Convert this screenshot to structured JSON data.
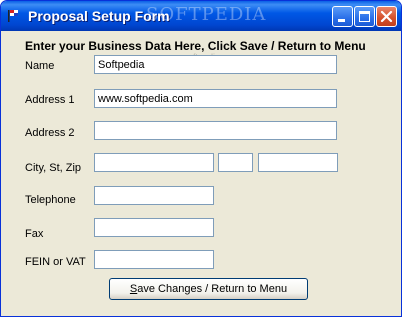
{
  "window": {
    "title": "Proposal Setup Form",
    "watermark": "SOFTPEDIA",
    "controls": {
      "minimize": "minimize",
      "maximize": "maximize",
      "close": "close"
    }
  },
  "form": {
    "heading": "Enter your Business Data Here, Click Save / Return to Menu",
    "sub_watermark": "www.softpedia.com",
    "fields": {
      "name": {
        "label": "Name",
        "value": "Softpedia"
      },
      "address1": {
        "label": "Address 1",
        "value": "www.softpedia.com"
      },
      "address2": {
        "label": "Address 2",
        "value": ""
      },
      "city_st_zip": {
        "label": "City, St, Zip",
        "city": "",
        "state": "",
        "zip": ""
      },
      "telephone": {
        "label": "Telephone",
        "value": ""
      },
      "fax": {
        "label": "Fax",
        "value": ""
      },
      "fein_vat": {
        "label": "FEIN or VAT",
        "value": ""
      }
    },
    "save_button": {
      "label_underlined": "S",
      "label_rest": "ave Changes / Return to Menu"
    }
  },
  "colors": {
    "titlebar": "#0058e6",
    "window_body": "#ece9d8",
    "field_border": "#7f9db9",
    "close_button": "#d4502a"
  },
  "icons": {
    "app": "flag-icon",
    "minimize": "minimize-icon",
    "maximize": "maximize-icon",
    "close": "close-icon"
  }
}
